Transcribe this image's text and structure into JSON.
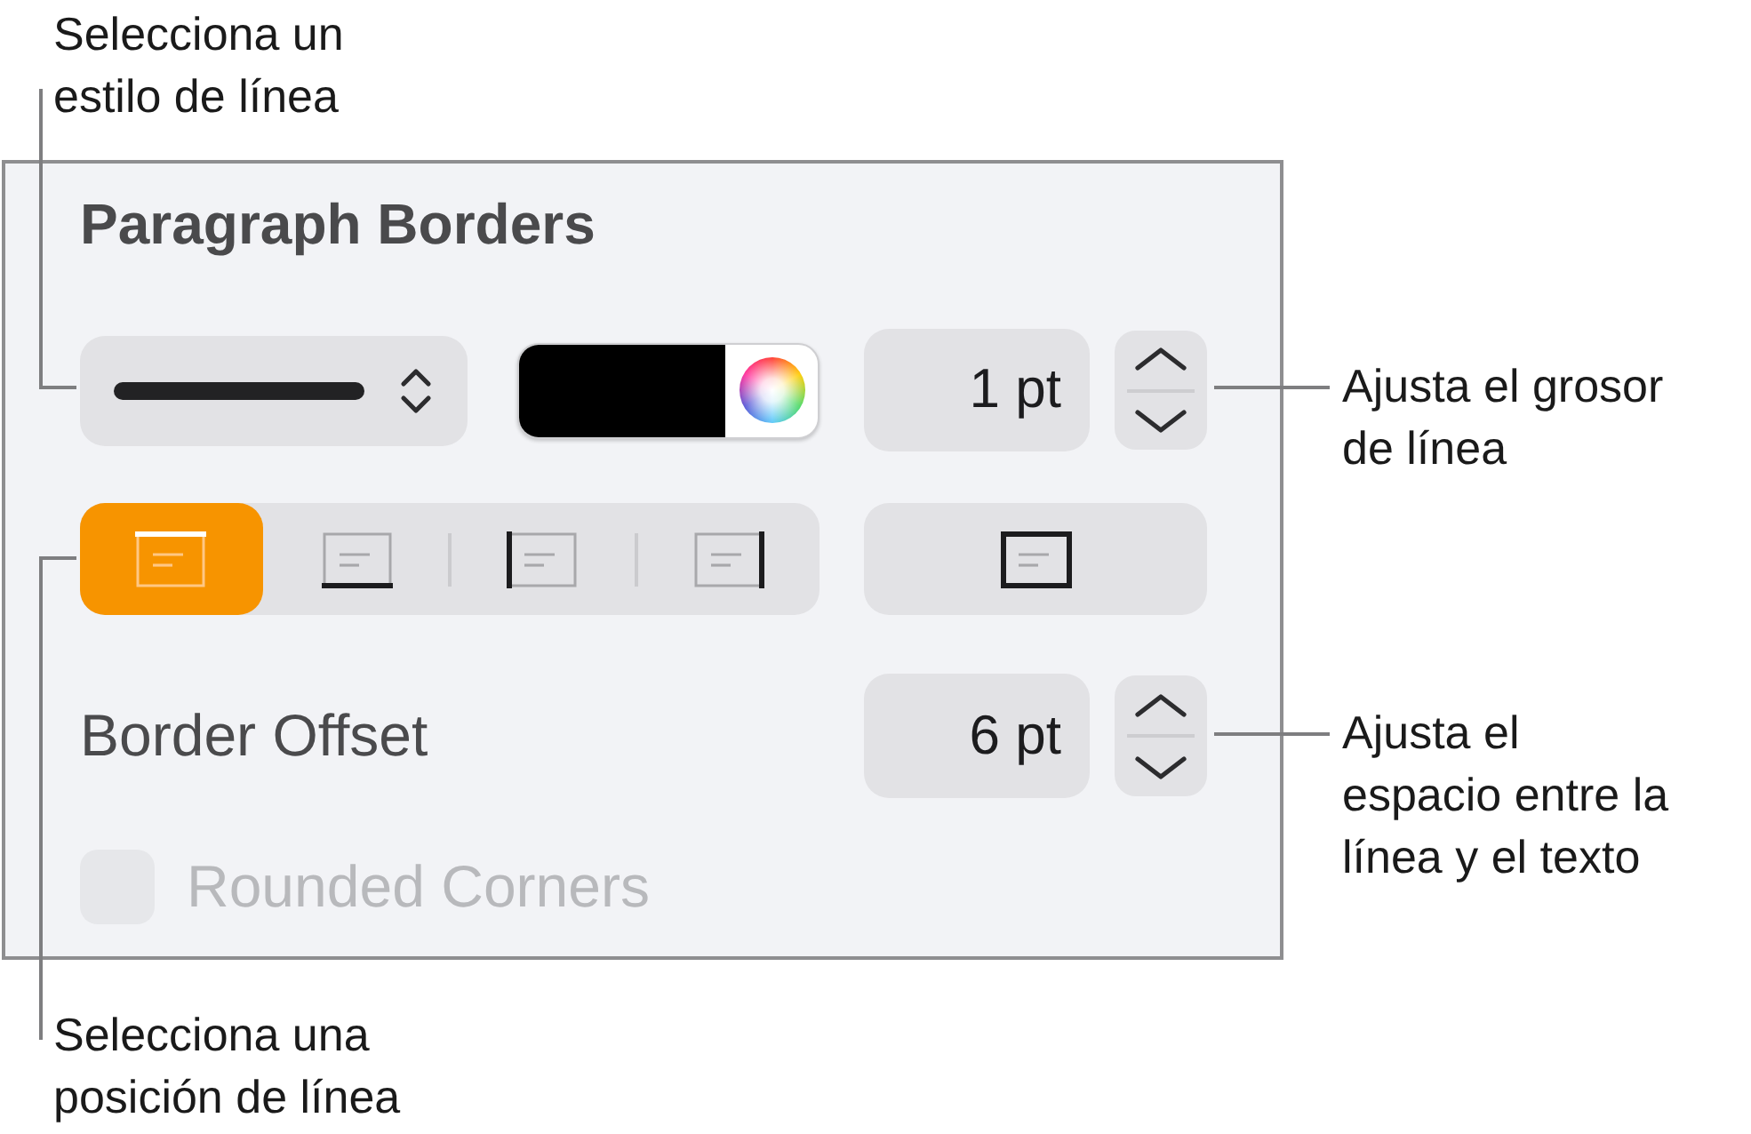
{
  "callouts": [
    {
      "text": "Selecciona un\nestilo de línea"
    },
    {
      "text": "Ajusta el grosor\nde línea"
    },
    {
      "text": "Ajusta el\nespacio entre la\nlínea y el texto"
    },
    {
      "text": "Selecciona una\nposición de línea"
    }
  ],
  "panel": {
    "title": "Paragraph Borders",
    "line_style": {
      "kind": "solid"
    },
    "color_well": {
      "color": "#000000"
    },
    "line_width": {
      "value": "1 pt"
    },
    "positions": [
      {
        "kind": "top",
        "selected": true
      },
      {
        "kind": "bottom",
        "selected": false
      },
      {
        "kind": "left",
        "selected": false
      },
      {
        "kind": "right",
        "selected": false
      }
    ],
    "outline_button": {
      "kind": "all",
      "selected": false
    },
    "offset": {
      "label": "Border Offset",
      "value": "6 pt"
    },
    "rounded_corners": {
      "label": "Rounded Corners",
      "checked": false,
      "disabled": true
    }
  }
}
